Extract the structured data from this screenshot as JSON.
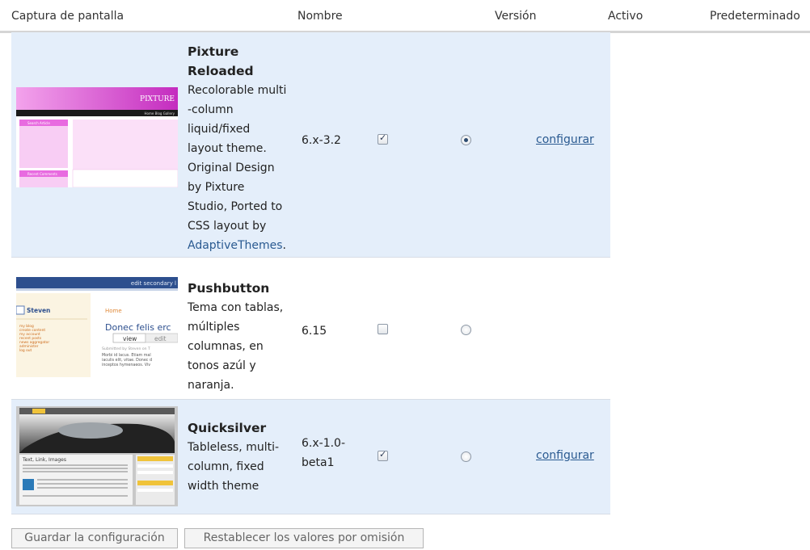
{
  "table": {
    "headers": {
      "screenshot": "Captura de pantalla",
      "name": "Nombre",
      "version": "Versión",
      "active": "Activo",
      "default": "Predeterminado"
    },
    "themes": [
      {
        "name_line1": "Pixture",
        "name_line2": "Reloaded",
        "desc_lines": [
          "Recolorable multi",
          "-column",
          "liquid/fixed",
          "layout theme.",
          "Original Design",
          "by Pixture",
          "Studio, Ported to",
          "CSS layout by"
        ],
        "desc_link": "AdaptiveThemes",
        "desc_end": ".",
        "version": "6.x-3.2",
        "active": true,
        "default": true,
        "configure_label": "configurar",
        "preview": {
          "logo": "PIXTURE",
          "nav": "Home  Blog  Gallery",
          "block1": "Search Article",
          "block2": "Recent Comments"
        }
      },
      {
        "name": "Pushbutton",
        "desc_lines": [
          "Tema con tablas,",
          "múltiples",
          "columnas, en",
          "tonos azúl y",
          "naranja."
        ],
        "version": "6.15",
        "active": false,
        "default": false,
        "preview": {
          "top": "edit secondary l",
          "user": "Steven",
          "home": "Home",
          "title": "Donec felis erc",
          "tab_view": "view",
          "tab_edit": "edit",
          "menu": [
            "my blog",
            "create content",
            "my account",
            "recent posts",
            "news aggregator",
            "administer",
            "log out"
          ],
          "sub": "Submitted by Steven on T",
          "body": [
            "Morbi id lacus. Etiam mal",
            "iaculis elit, vitae. Donec d",
            "inceptos hymenaeos. Viv"
          ]
        }
      },
      {
        "name": "Quicksilver",
        "desc_lines": [
          "Tableless, multi-",
          "column, fixed",
          "width theme"
        ],
        "version_line1": "6.x-1.0-",
        "version_line2": "beta1",
        "active": true,
        "default": false,
        "configure_label": "configurar",
        "preview": {
          "title": "Text, Link, Images"
        }
      }
    ]
  },
  "buttons": {
    "save": "Guardar la configuración",
    "reset": "Restablecer los valores por omisión"
  }
}
